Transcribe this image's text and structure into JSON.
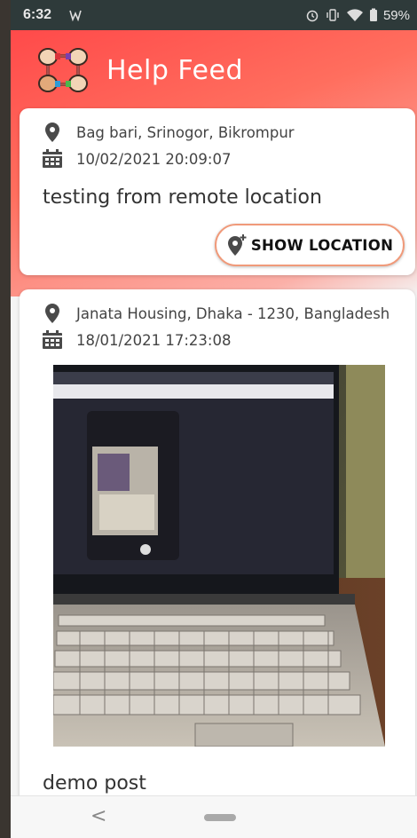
{
  "status_bar": {
    "time": "6:32",
    "battery": "59%"
  },
  "app_bar": {
    "title": "Help Feed",
    "logo_icon": "helping-hands-icon"
  },
  "posts": [
    {
      "location": "Bag bari, Srinogor, Bikrompur",
      "datetime": "10/02/2021 20:09:07",
      "text": "testing from remote location",
      "button_label": "SHOW LOCATION"
    },
    {
      "location": "Janata Housing, Dhaka - 1230, Bangladesh",
      "datetime": "18/01/2021 17:23:08",
      "text": "demo post"
    }
  ],
  "colors": {
    "header_red": "#ff4a4a",
    "button_border": "#f09a7a",
    "icon_gray": "#4a4a4a"
  }
}
